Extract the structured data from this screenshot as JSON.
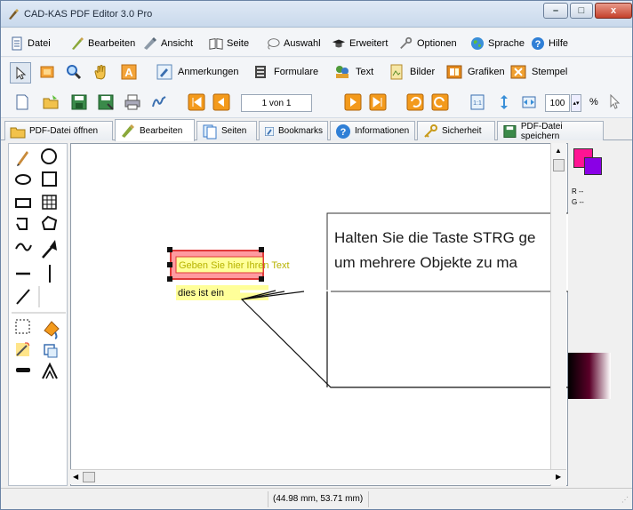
{
  "window": {
    "title": "CAD-KAS PDF Editor 3.0 Pro",
    "minimize": "–",
    "maximize": "□",
    "close": "x"
  },
  "menu": [
    {
      "label": "Datei",
      "icon": "document-icon"
    },
    {
      "label": "Bearbeiten",
      "icon": "edit-pen-icon"
    },
    {
      "label": "Ansicht",
      "icon": "view-pen-icon"
    },
    {
      "label": "Seite",
      "icon": "book-icon"
    },
    {
      "label": "Auswahl",
      "icon": "lasso-icon"
    },
    {
      "label": "Erweitert",
      "icon": "graduation-cap-icon"
    },
    {
      "label": "Optionen",
      "icon": "tools-icon"
    },
    {
      "label": "Sprache",
      "icon": "globe-icon"
    },
    {
      "label": "Hilfe",
      "icon": "help-icon"
    }
  ],
  "toolbar1": {
    "anmerkungen": "Anmerkungen",
    "formulare": "Formulare",
    "text": "Text",
    "bilder": "Bilder",
    "grafiken": "Grafiken",
    "stempel": "Stempel"
  },
  "toolbar2": {
    "page_value": "1 von 1",
    "zoom_value": "100",
    "zoom_unit": "%"
  },
  "tabs": [
    {
      "label": "PDF-Datei öffnen",
      "icon": "open-folder-icon"
    },
    {
      "label": "Bearbeiten",
      "icon": "edit-pen-icon"
    },
    {
      "label": "Seiten",
      "icon": "pages-icon"
    },
    {
      "label": "Bookmarks",
      "icon": "bookmark-icon"
    },
    {
      "label": "Informationen",
      "icon": "info-icon"
    },
    {
      "label": "Sicherheit",
      "icon": "key-icon"
    },
    {
      "label": "PDF-Datei speichern",
      "icon": "save-icon"
    }
  ],
  "canvas": {
    "textbox_text": "Geben Sie hier Ihren Text",
    "note_text": "dies ist ein",
    "callout_line1": "Halten Sie die Taste STRG ge",
    "callout_line2": "um mehrere Objekte zu ma"
  },
  "color_panel": {
    "r_label": "R --",
    "g_label": "G --"
  },
  "status": {
    "coordinates": "(44.98 mm, 53.71 mm)"
  },
  "colors": {
    "accent": "#ff1493",
    "secondary": "#8a00e6",
    "selection_fill": "#ff9aa0",
    "note_fill": "#ffff99"
  }
}
